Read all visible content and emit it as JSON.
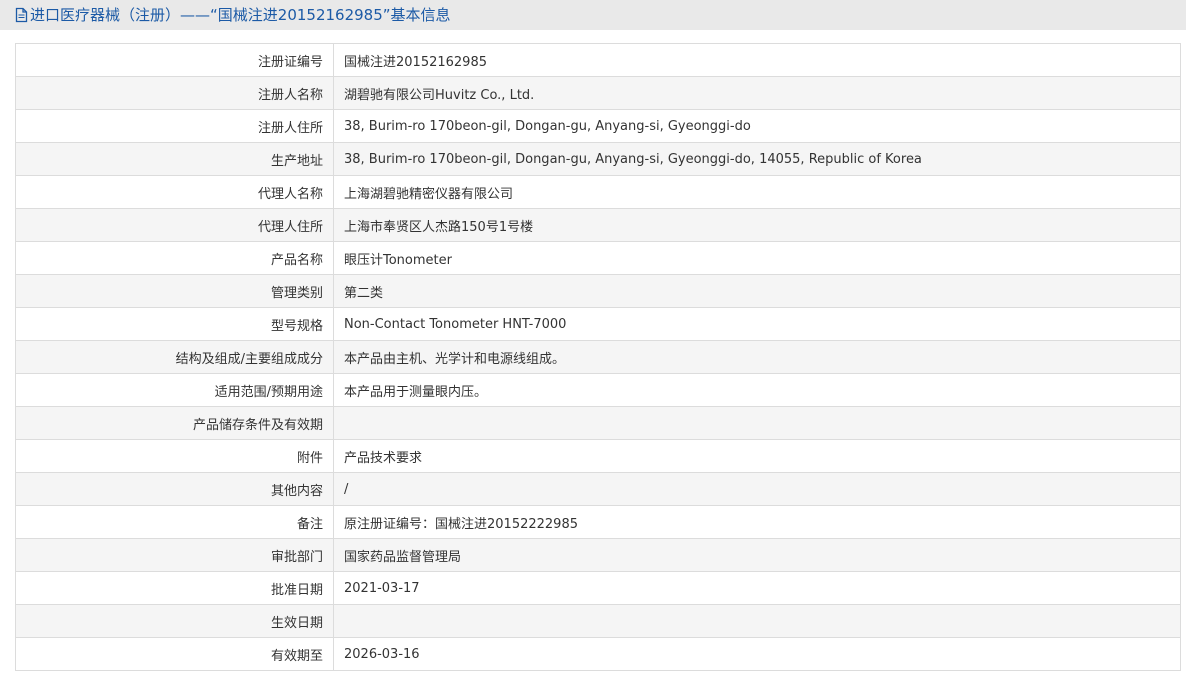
{
  "header": {
    "title": "进口医疗器械（注册）——“国械注进20152162985”基本信息",
    "icon": "document-icon",
    "title_color": "#1c5aa6"
  },
  "table": {
    "rows": [
      {
        "label": "注册证编号",
        "value": "国械注进20152162985"
      },
      {
        "label": "注册人名称",
        "value": "湖碧驰有限公司Huvitz Co., Ltd."
      },
      {
        "label": "注册人住所",
        "value": "38, Burim-ro 170beon-gil, Dongan-gu, Anyang-si, Gyeonggi-do"
      },
      {
        "label": "生产地址",
        "value": "38, Burim-ro 170beon-gil, Dongan-gu, Anyang-si, Gyeonggi-do, 14055, Republic of Korea"
      },
      {
        "label": "代理人名称",
        "value": "上海湖碧驰精密仪器有限公司"
      },
      {
        "label": "代理人住所",
        "value": "上海市奉贤区人杰路150号1号楼"
      },
      {
        "label": "产品名称",
        "value": "眼压计Tonometer"
      },
      {
        "label": "管理类别",
        "value": "第二类"
      },
      {
        "label": "型号规格",
        "value": "Non-Contact Tonometer HNT-7000"
      },
      {
        "label": "结构及组成/主要组成成分",
        "value": "本产品由主机、光学计和电源线组成。"
      },
      {
        "label": "适用范围/预期用途",
        "value": "本产品用于测量眼内压。"
      },
      {
        "label": "产品储存条件及有效期",
        "value": ""
      },
      {
        "label": "附件",
        "value": "产品技术要求"
      },
      {
        "label": "其他内容",
        "value": "/"
      },
      {
        "label": "备注",
        "value": "原注册证编号：国械注进20152222985"
      },
      {
        "label": "审批部门",
        "value": "国家药品监督管理局"
      },
      {
        "label": "批准日期",
        "value": "2021-03-17"
      },
      {
        "label": "生效日期",
        "value": ""
      },
      {
        "label": "有效期至",
        "value": "2026-03-16"
      }
    ]
  }
}
